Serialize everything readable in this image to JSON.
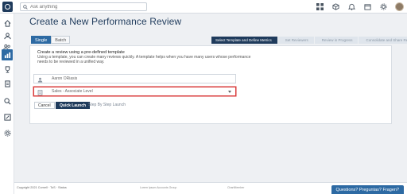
{
  "topbar": {
    "search_placeholder": "Ask anything"
  },
  "sidebar": {
    "items": [
      {
        "icon": "home-icon"
      },
      {
        "icon": "people-icon"
      },
      {
        "icon": "people-group-icon"
      },
      {
        "icon": "chart-icon",
        "active": true
      },
      {
        "icon": "trophy-icon"
      },
      {
        "icon": "document-icon"
      },
      {
        "icon": "search-people-icon"
      },
      {
        "icon": "edit-icon"
      },
      {
        "icon": "settings-icon"
      }
    ]
  },
  "page": {
    "title": "Create a New Performance Review"
  },
  "tabs": [
    {
      "label": "Single",
      "active": true
    },
    {
      "label": "Batch",
      "active": false
    }
  ],
  "wizard": {
    "steps": [
      "Select Template and Define Metrics",
      "Set Reviewers",
      "Review in Progress",
      "Consolidate and Share Results"
    ],
    "active_index": 0
  },
  "card": {
    "heading": "Create a review using a pre-defined template",
    "description": "Using a template, you can create many reviews quickly. A template helps when you have many users whose performance needs to be reviewed in a unified way.",
    "employee_value": "Aaron ORiasis",
    "template_value": "Sales - Associate Level",
    "cancel_label": "Cancel",
    "quick_launch_label": "Quick Launch",
    "step_launch_label": "Step By Step Launch"
  },
  "footer": {
    "copyright": "Copyright 2021 Cornell · ToS · Status",
    "center_text": "Lorem Ipsum Accounts Group",
    "center_text2": "ChartMember",
    "help_label": "Questions? Preguntas? Fragen?"
  },
  "colors": {
    "primary": "#2d6aa3",
    "dark": "#1f3b5c",
    "highlight_border": "#d93b3b"
  }
}
